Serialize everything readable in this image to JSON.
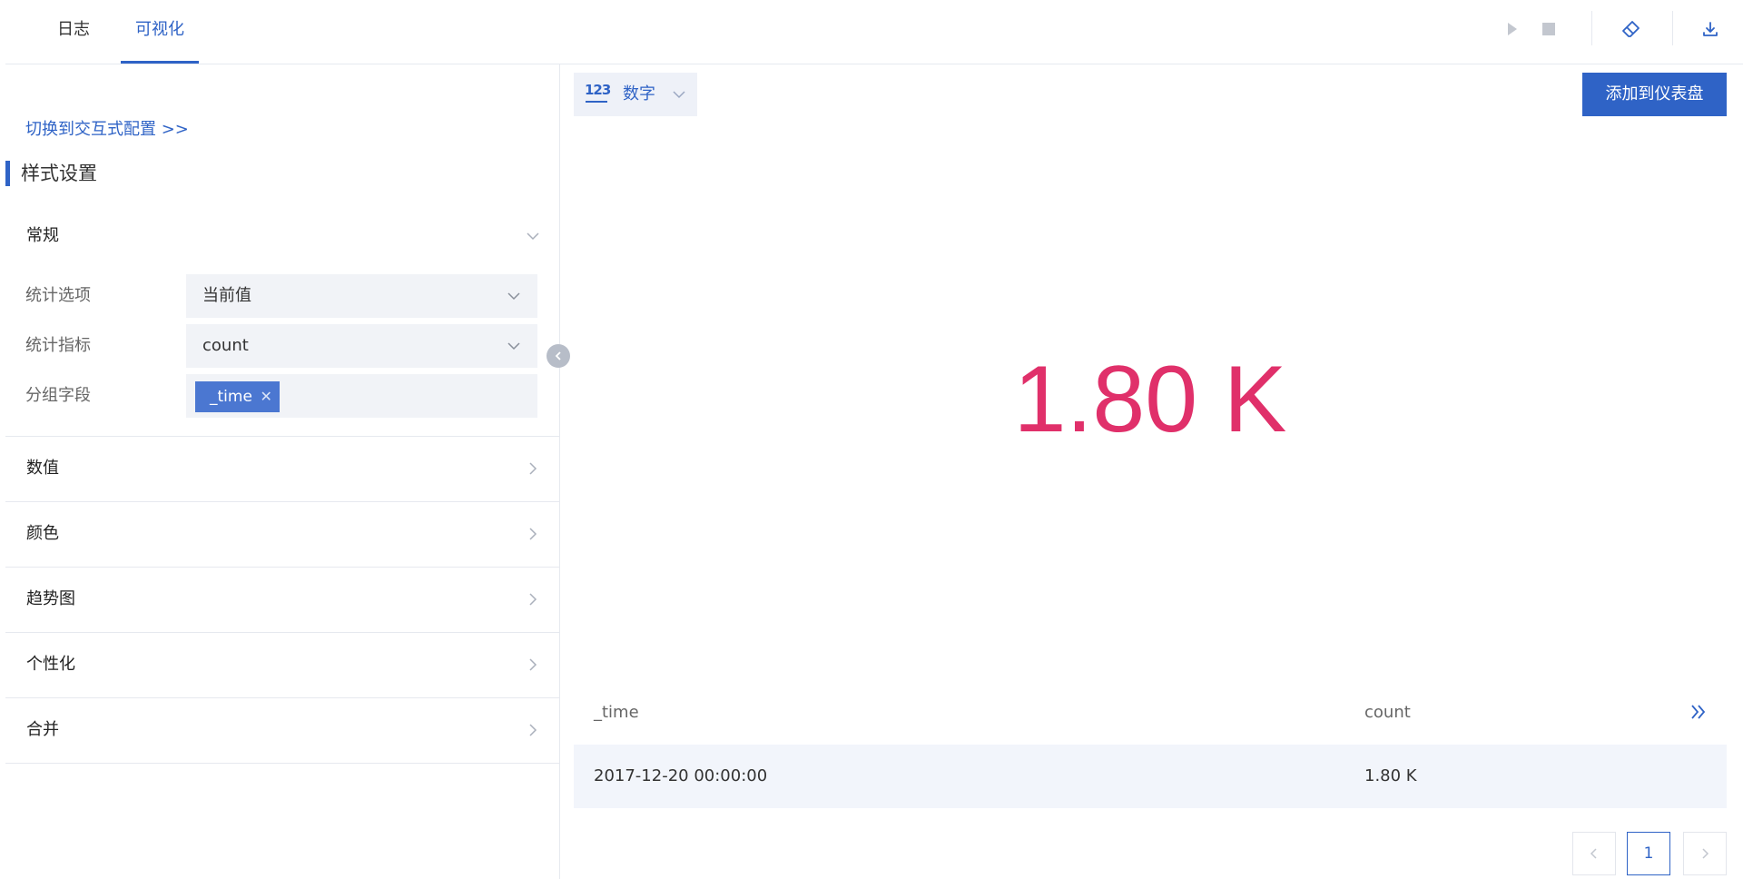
{
  "tabs": [
    {
      "label": "日志",
      "active": false
    },
    {
      "label": "可视化",
      "active": true
    }
  ],
  "toolbar": {
    "icons": [
      "play-icon",
      "stop-icon",
      "eraser-icon",
      "download-icon"
    ]
  },
  "left_panel": {
    "switch_link": "切换到交互式配置 >>",
    "section_title": "样式设置",
    "general": {
      "label": "常规",
      "fields": [
        {
          "label": "统计选项",
          "value": "当前值"
        },
        {
          "label": "统计指标",
          "value": "count"
        },
        {
          "label": "分组字段",
          "tags": [
            "_time"
          ]
        }
      ]
    },
    "groups": [
      {
        "label": "数值"
      },
      {
        "label": "颜色"
      },
      {
        "label": "趋势图"
      },
      {
        "label": "个性化"
      },
      {
        "label": "合并"
      }
    ]
  },
  "viz": {
    "type_icon_text": "123",
    "type_label": "数字",
    "add_button": "添加到仪表盘",
    "value": "1.80 K",
    "value_color": "#e0306a",
    "accent": "#2f63c6"
  },
  "table": {
    "columns": [
      "_time",
      "count"
    ],
    "rows": [
      [
        "2017-12-20 00:00:00",
        "1.80 K"
      ]
    ]
  },
  "pagination": {
    "current": "1"
  }
}
